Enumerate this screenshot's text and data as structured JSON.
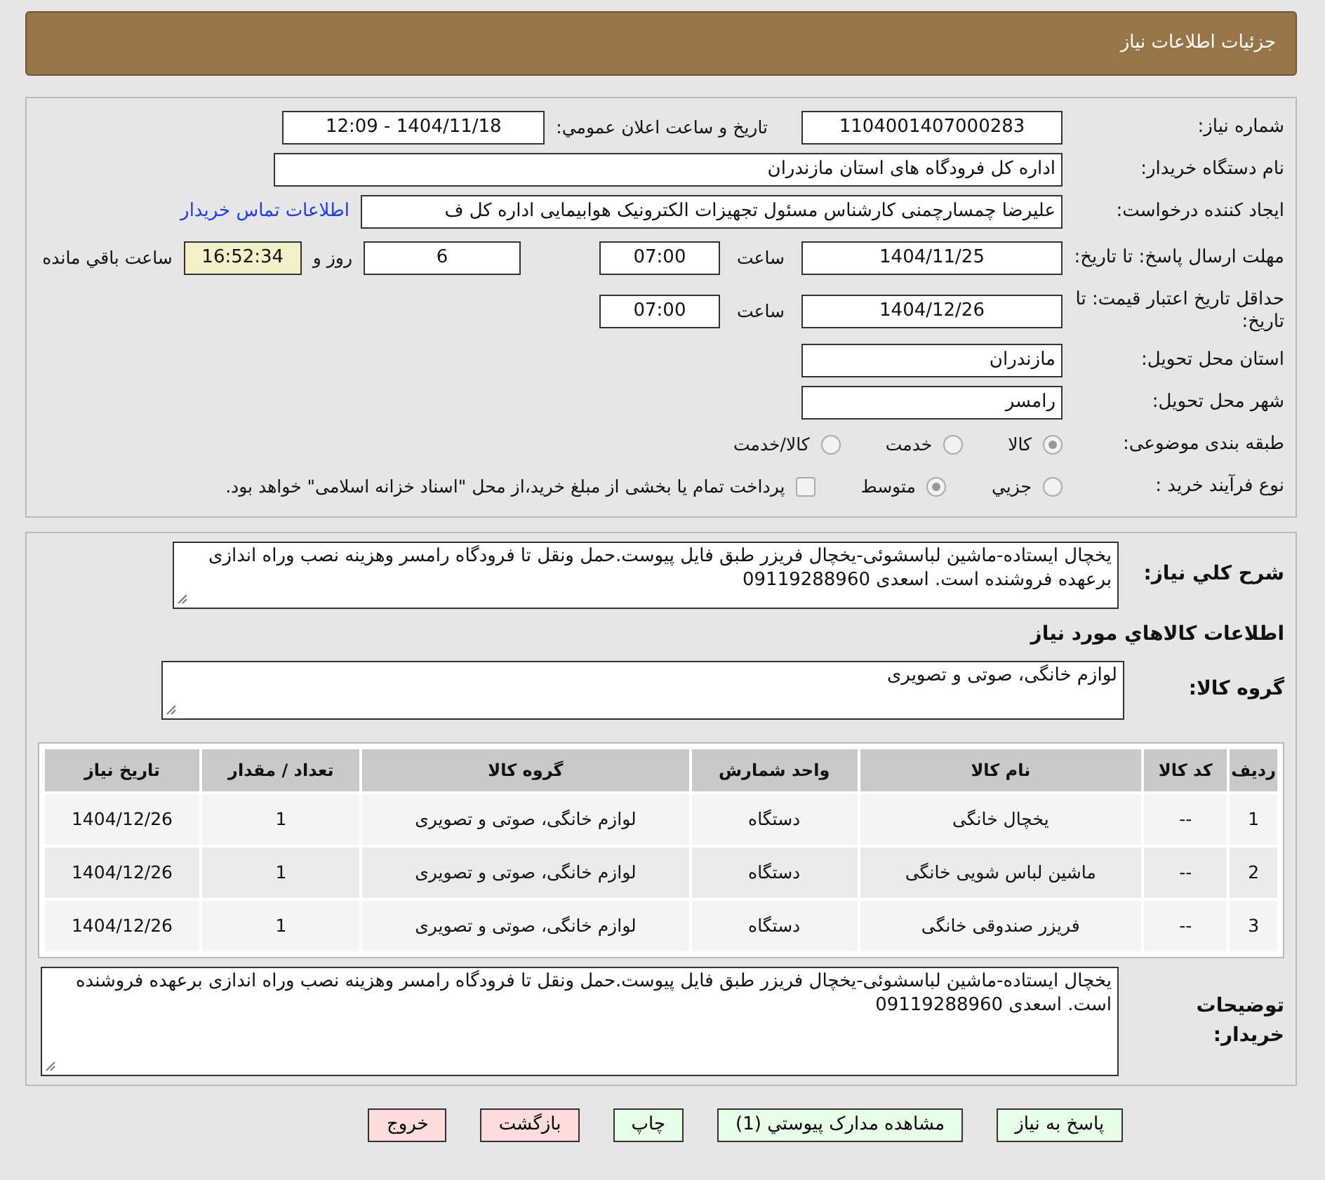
{
  "header": {
    "title": "جزئیات اطلاعات نیاز"
  },
  "need_info": {
    "need_number": {
      "label": "شماره نیاز:",
      "value": "1104001407000283"
    },
    "announce": {
      "label": "تاریخ و ساعت اعلان عمومي:",
      "value": "1404/11/18 - 12:09"
    },
    "buyer": {
      "label": "نام دستگاه خریدار:",
      "value": "اداره کل فرودگاه های استان مازندران"
    },
    "requester": {
      "label": "ایجاد کننده درخواست:",
      "value": "علیرضا چمسارچمنی کارشناس مسئول تجهیزات الکترونیک هوابیمایی اداره کل ف",
      "link": "اطلاعات تماس خریدار"
    },
    "reply_deadline": {
      "label": "مهلت ارسال پاسخ: تا تاریخ:",
      "date": "1404/11/25",
      "time_label": "ساعت",
      "time": "07:00",
      "days": "6",
      "days_suffix": "روز و",
      "remaining": "16:52:34",
      "remaining_suffix": "ساعت باقي مانده"
    },
    "price_validity": {
      "label": "حداقل تاریخ اعتبار قیمت: تا تاریخ:",
      "date": "1404/12/26",
      "time_label": "ساعت",
      "time": "07:00"
    },
    "province": {
      "label": "استان محل تحویل:",
      "value": "مازندران"
    },
    "city": {
      "label": "شهر محل تحویل:",
      "value": "رامسر"
    },
    "category": {
      "label": "طبقه بندی موضوعی:",
      "options": [
        {
          "label": "کالا",
          "selected": true
        },
        {
          "label": "خدمت",
          "selected": false
        },
        {
          "label": "کالا/خدمت",
          "selected": false
        }
      ]
    },
    "process": {
      "label": "نوع فرآیند خرید :",
      "options": [
        {
          "label": "جزيي",
          "selected": false
        },
        {
          "label": "متوسط",
          "selected": true
        }
      ],
      "payment": {
        "label": "پرداخت تمام یا بخشی از مبلغ خرید،از محل \"اسناد خزانه اسلامی\" خواهد بود.",
        "checked": false
      }
    }
  },
  "description": {
    "label": "شرح کلي نیاز:",
    "value": "یخچال ایستاده-ماشین لباسشوئی-یخچال فریزر طبق فایل پیوست.حمل ونقل تا فرودگاه رامسر وهزینه نصب وراه اندازی برعهده فروشنده است. اسعدی 09119288960"
  },
  "goods_heading": "اطلاعات کالاهاي مورد نیاز",
  "goods_group": {
    "label": "گروه کالا:",
    "value": "لوازم خانگی، صوتی و تصویری"
  },
  "table": {
    "columns": [
      "ردیف",
      "کد کالا",
      "نام کالا",
      "واحد شمارش",
      "گروه کالا",
      "تعداد / مقدار",
      "تاریخ نیاز"
    ],
    "rows": [
      [
        "1",
        "--",
        "یخچال خانگی",
        "دستگاه",
        "لوازم خانگی، صوتی و تصویری",
        "1",
        "1404/12/26"
      ],
      [
        "2",
        "--",
        "ماشین لباس شویی خانگی",
        "دستگاه",
        "لوازم خانگی، صوتی و تصویری",
        "1",
        "1404/12/26"
      ],
      [
        "3",
        "--",
        "فریزر صندوقی خانگی",
        "دستگاه",
        "لوازم خانگی، صوتی و تصویری",
        "1",
        "1404/12/26"
      ]
    ]
  },
  "buyer_notes": {
    "label": "توضیحات خریدار:",
    "value": "یخچال ایستاده-ماشین لباسشوئی-یخچال فریزر طبق فایل پیوست.حمل ونقل تا فرودگاه رامسر وهزینه نصب وراه اندازی برعهده فروشنده است. اسعدی 09119288960"
  },
  "buttons": [
    {
      "label": "پاسخ به نیاز",
      "kind": "green"
    },
    {
      "label": "مشاهده مدارک پیوستي (1)",
      "kind": "green"
    },
    {
      "label": "چاپ",
      "kind": "green"
    },
    {
      "label": "بازگشت",
      "kind": "red"
    },
    {
      "label": "خروج",
      "kind": "red"
    }
  ]
}
